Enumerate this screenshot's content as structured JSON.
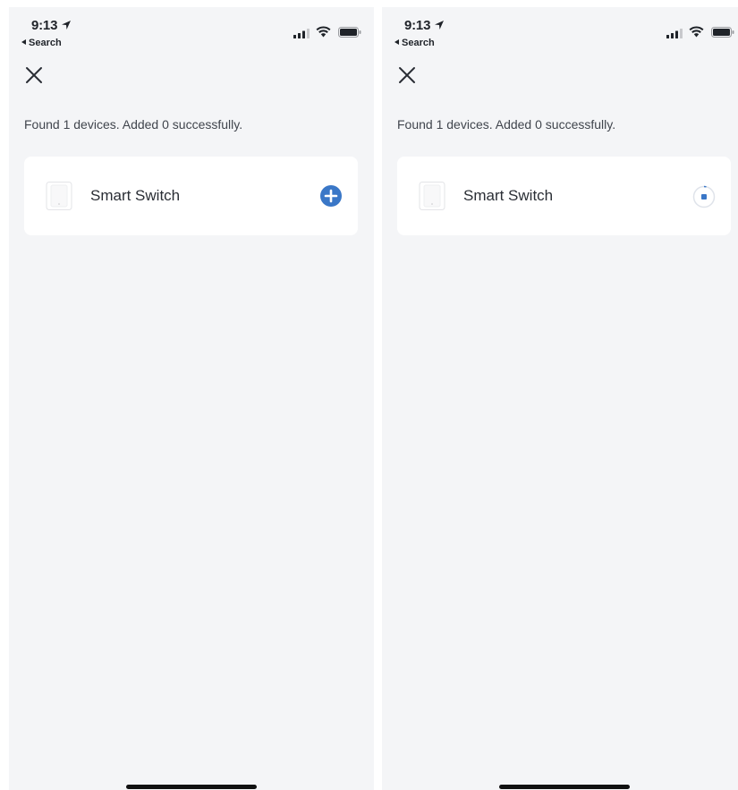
{
  "screens": [
    {
      "status_bar": {
        "time": "9:13",
        "back_app": "Search"
      },
      "found_text": "Found 1 devices. Added 0 successfully.",
      "device": {
        "name": "Smart Switch",
        "action": "add",
        "action_icon": "plus-circle-icon",
        "accent_color": "#3a77c7"
      }
    },
    {
      "status_bar": {
        "time": "9:13",
        "back_app": "Search"
      },
      "found_text": "Found 1 devices. Added 0 successfully.",
      "device": {
        "name": "Smart Switch",
        "action": "adding",
        "action_icon": "progress-spinner-icon",
        "accent_color": "#3a77c7"
      }
    }
  ]
}
